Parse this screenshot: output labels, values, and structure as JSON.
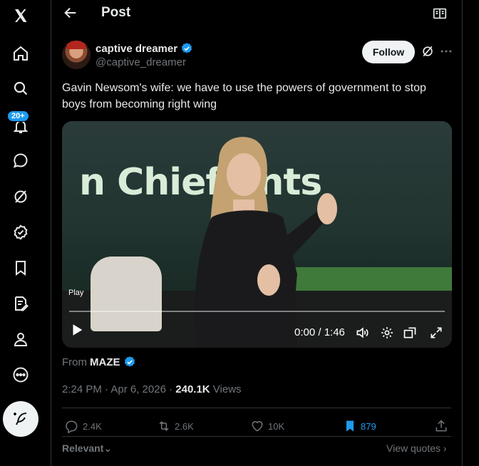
{
  "nav": {
    "items": [
      {
        "name": "x-logo-icon"
      },
      {
        "name": "home-icon"
      },
      {
        "name": "search-icon"
      },
      {
        "name": "notifications-icon"
      },
      {
        "name": "messages-icon"
      },
      {
        "name": "grok-icon"
      },
      {
        "name": "verified-orgs-icon"
      },
      {
        "name": "bookmarks-icon"
      },
      {
        "name": "lists-icon"
      },
      {
        "name": "profile-icon"
      },
      {
        "name": "more-icon"
      }
    ],
    "notification_badge": "20+",
    "compose_icon": "compose-icon"
  },
  "header": {
    "title": "Post"
  },
  "post": {
    "author_name": "captive dreamer",
    "author_handle": "@captive_dreamer",
    "follow_label": "Follow",
    "text": "Gavin Newsom's wife: we have to use the powers of government to stop boys from becoming right wing",
    "video": {
      "banner_text": "n Chief ents",
      "play_label": "Play",
      "time": "0:00 / 1:46",
      "progress": 0
    },
    "from_prefix": "From",
    "from_source": "MAZE",
    "timestamp": "2:24 PM · Apr 6, 2026 · ",
    "views_count": "240.1K",
    "views_label": " Views",
    "actions": {
      "replies": "2.4K",
      "reposts": "2.6K",
      "likes": "10K",
      "bookmarks": "879"
    },
    "relevant_label": "Relevant",
    "view_quotes_label": "View quotes"
  },
  "colors": {
    "accent": "#1d9bf0",
    "background": "#000000",
    "muted": "#71767b",
    "stage_green": "#3f7a3a"
  }
}
